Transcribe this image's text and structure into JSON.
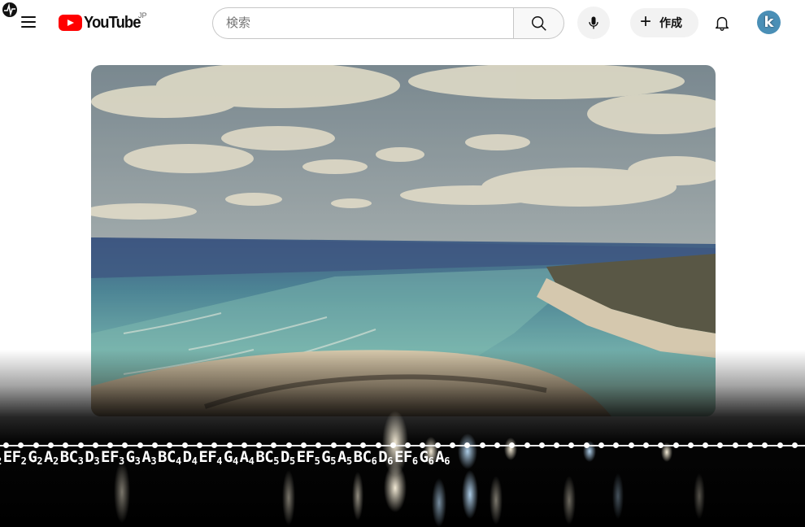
{
  "header": {
    "logo_text": "YouTube",
    "region": "JP",
    "search_placeholder": "検索",
    "create_label": "作成",
    "avatar_letter": "k"
  },
  "visualizer": {
    "notes": [
      {
        "n": "",
        "o": "2"
      },
      {
        "n": "EF",
        "o": "2"
      },
      {
        "n": "G",
        "o": "2"
      },
      {
        "n": "A",
        "o": "2"
      },
      {
        "n": "BC",
        "o": "3"
      },
      {
        "n": "D",
        "o": "3"
      },
      {
        "n": "EF",
        "o": "3"
      },
      {
        "n": "G",
        "o": "3"
      },
      {
        "n": "A",
        "o": "3"
      },
      {
        "n": "BC",
        "o": "4"
      },
      {
        "n": "D",
        "o": "4"
      },
      {
        "n": "EF",
        "o": "4"
      },
      {
        "n": "G",
        "o": "4"
      },
      {
        "n": "A",
        "o": "4"
      },
      {
        "n": "BC",
        "o": "5"
      },
      {
        "n": "D",
        "o": "5"
      },
      {
        "n": "EF",
        "o": "5"
      },
      {
        "n": "G",
        "o": "5"
      },
      {
        "n": "A",
        "o": "5"
      },
      {
        "n": "BC",
        "o": "6"
      },
      {
        "n": "D",
        "o": "6"
      },
      {
        "n": "EF",
        "o": "6"
      },
      {
        "n": "G",
        "o": "6"
      },
      {
        "n": "A",
        "o": "6"
      }
    ]
  },
  "colors": {
    "brand_red": "#ff0000",
    "header_bg": "#ffffff",
    "visualizer_bg": "#000000"
  }
}
